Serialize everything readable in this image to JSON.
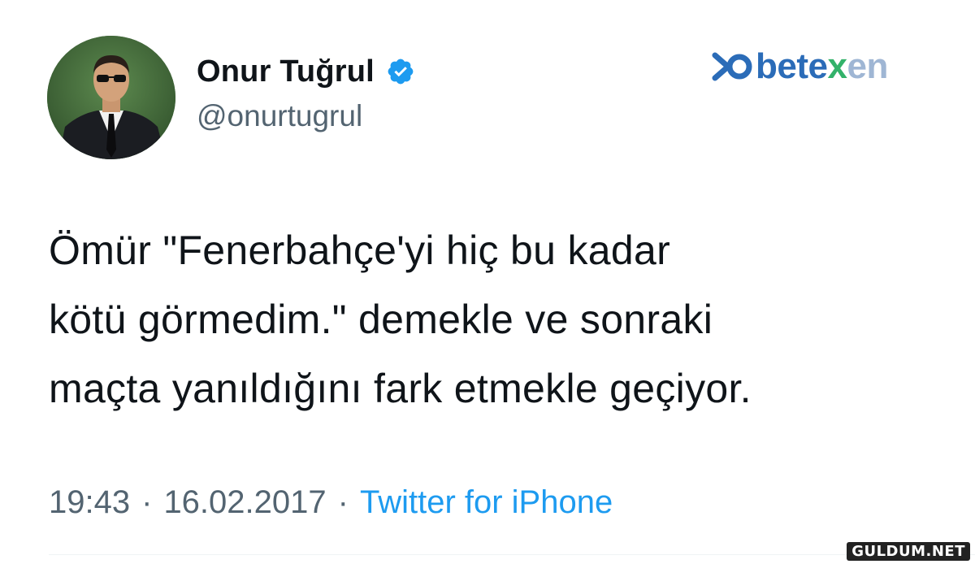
{
  "author": {
    "display_name": "Onur Tuğrul",
    "handle": "@onurtugrul",
    "verified": true,
    "avatar_icon": "profile-photo-man-in-suit"
  },
  "brand_logo": {
    "part1": "bet",
    "part2": "e",
    "part3": "x",
    "part4": "en",
    "icon": "betexen-logo-icon",
    "colors": {
      "primary": "#2b6cb8",
      "accent": "#33b26a"
    }
  },
  "tweet": {
    "text": "Ömür \"Fenerbahçe'yi hiç bu kadar\nkötü görmedim.\" demekle ve sonraki\nmaçta yanıldığını fark etmekle geçiyor."
  },
  "meta": {
    "time": "19:43",
    "separator": "·",
    "date": "16.02.2017",
    "source": "Twitter for iPhone"
  },
  "watermark": {
    "text": "GULDUM.NET"
  },
  "colors": {
    "text": "#0f1419",
    "secondary": "#536471",
    "link": "#1d9bf0",
    "verified": "#1d9bf0"
  }
}
